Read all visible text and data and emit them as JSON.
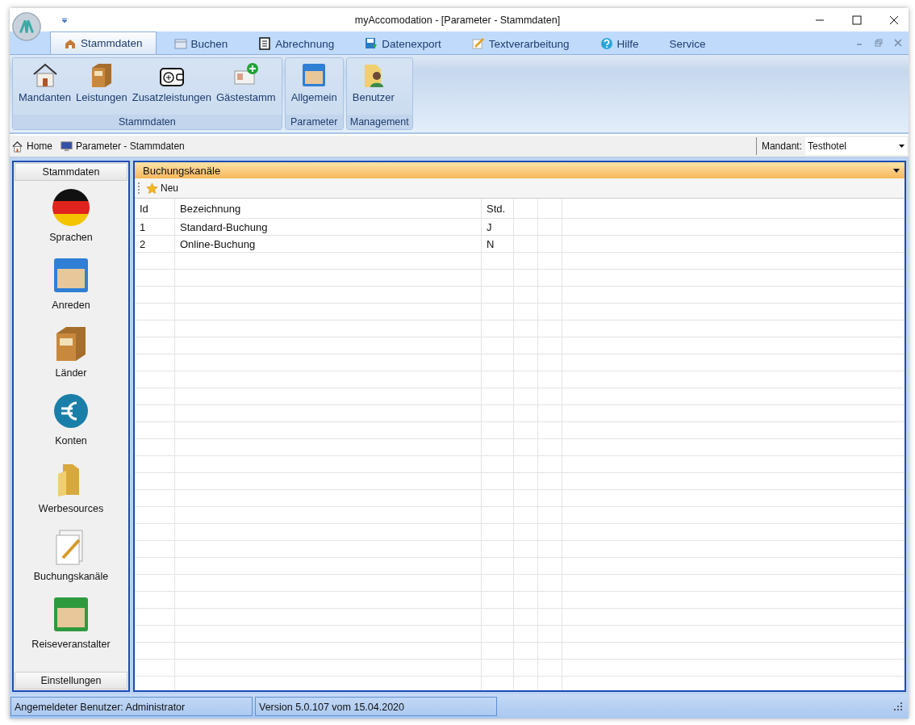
{
  "window": {
    "title": "myAccomodation - [Parameter - Stammdaten]"
  },
  "tabs": [
    {
      "label": "Stammdaten",
      "selected": true
    },
    {
      "label": "Buchen",
      "selected": false
    },
    {
      "label": "Abrechnung",
      "selected": false
    },
    {
      "label": "Datenexport",
      "selected": false
    },
    {
      "label": "Textverarbeitung",
      "selected": false
    },
    {
      "label": "Hilfe",
      "selected": false
    },
    {
      "label": "Service",
      "selected": false
    }
  ],
  "ribbon_groups": [
    {
      "label": "Stammdaten",
      "buttons": [
        "Mandanten",
        "Leistungen",
        "Zusatzleistungen",
        "Gästestamm"
      ]
    },
    {
      "label": "Parameter",
      "buttons": [
        "Allgemein"
      ]
    },
    {
      "label": "Management",
      "buttons": [
        "Benutzer"
      ]
    }
  ],
  "breadcrumb": [
    "Home",
    "Parameter - Stammdaten"
  ],
  "mandant": {
    "label": "Mandant:",
    "value": "Testhotel"
  },
  "sidebar": {
    "header": "Stammdaten",
    "items": [
      "Sprachen",
      "Anreden",
      "Länder",
      "Konten",
      "Werbesources",
      "Buchungskanäle",
      "Reiseveranstalter"
    ],
    "footer": "Einstellungen"
  },
  "panel": {
    "title": "Buchungskanäle",
    "toolbar_button": "Neu",
    "columns": [
      "Id",
      "Bezeichnung",
      "Std."
    ],
    "rows": [
      [
        "1",
        "Standard-Buchung",
        "J"
      ],
      [
        "2",
        "Online-Buchung",
        "N"
      ]
    ]
  },
  "status_bar": [
    "Angemeldeter Benutzer: Administrator",
    "Version 5.0.107 vom 15.04.2020"
  ]
}
